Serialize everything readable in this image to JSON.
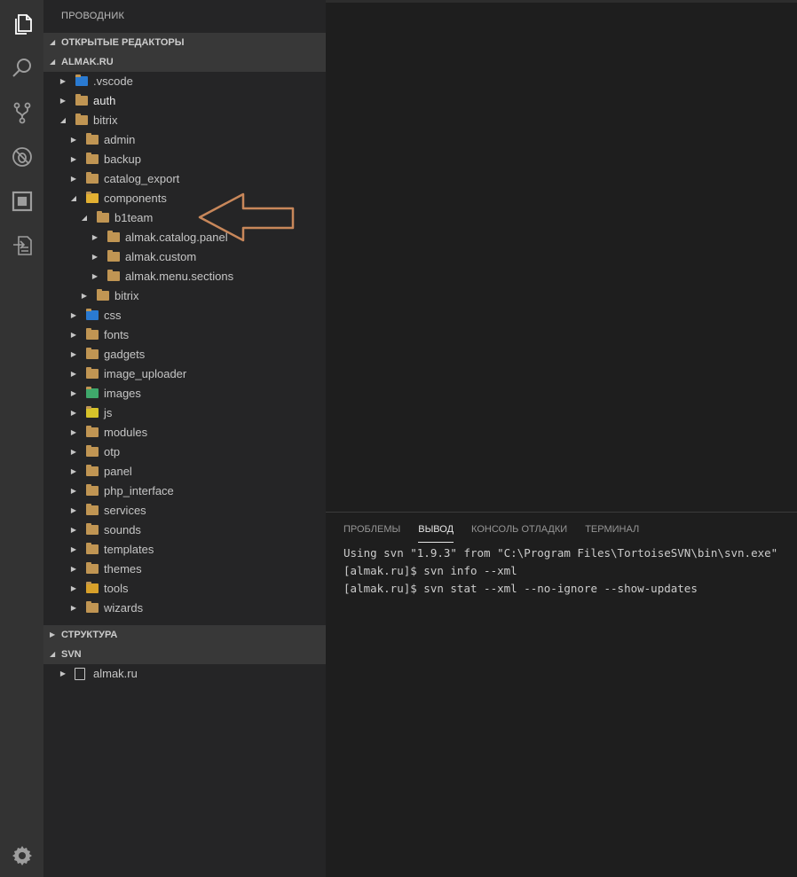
{
  "activity_bar": {
    "items": [
      "files-icon",
      "search-icon",
      "source-control-icon",
      "debug-icon",
      "extensions-icon",
      "remote-icon"
    ],
    "settings": "gear-icon"
  },
  "sidebar": {
    "title": "ПРОВОДНИК",
    "open_editors": "ОТКРЫТЫЕ РЕДАКТОРЫ",
    "workspace": "ALMAK.RU",
    "tree": [
      {
        "label": ".vscode",
        "depth": 0,
        "expanded": false,
        "icon": "vscode-folder"
      },
      {
        "label": "auth",
        "depth": 0,
        "expanded": false,
        "icon": "folder",
        "bold": true
      },
      {
        "label": "bitrix",
        "depth": 0,
        "expanded": true,
        "icon": "folder-open"
      },
      {
        "label": "admin",
        "depth": 1,
        "expanded": false,
        "icon": "folder"
      },
      {
        "label": "backup",
        "depth": 1,
        "expanded": false,
        "icon": "folder"
      },
      {
        "label": "catalog_export",
        "depth": 1,
        "expanded": false,
        "icon": "folder"
      },
      {
        "label": "components",
        "depth": 1,
        "expanded": true,
        "icon": "folder-component"
      },
      {
        "label": "b1team",
        "depth": 2,
        "expanded": true,
        "icon": "folder-open"
      },
      {
        "label": "almak.catalog.panel",
        "depth": 3,
        "expanded": false,
        "icon": "folder"
      },
      {
        "label": "almak.custom",
        "depth": 3,
        "expanded": false,
        "icon": "folder"
      },
      {
        "label": "almak.menu.sections",
        "depth": 3,
        "expanded": false,
        "icon": "folder"
      },
      {
        "label": "bitrix",
        "depth": 2,
        "expanded": false,
        "icon": "folder"
      },
      {
        "label": "css",
        "depth": 1,
        "expanded": false,
        "icon": "folder-css"
      },
      {
        "label": "fonts",
        "depth": 1,
        "expanded": false,
        "icon": "folder-fonts"
      },
      {
        "label": "gadgets",
        "depth": 1,
        "expanded": false,
        "icon": "folder"
      },
      {
        "label": "image_uploader",
        "depth": 1,
        "expanded": false,
        "icon": "folder"
      },
      {
        "label": "images",
        "depth": 1,
        "expanded": false,
        "icon": "folder-images"
      },
      {
        "label": "js",
        "depth": 1,
        "expanded": false,
        "icon": "folder-js"
      },
      {
        "label": "modules",
        "depth": 1,
        "expanded": false,
        "icon": "folder"
      },
      {
        "label": "otp",
        "depth": 1,
        "expanded": false,
        "icon": "folder"
      },
      {
        "label": "panel",
        "depth": 1,
        "expanded": false,
        "icon": "folder"
      },
      {
        "label": "php_interface",
        "depth": 1,
        "expanded": false,
        "icon": "folder"
      },
      {
        "label": "services",
        "depth": 1,
        "expanded": false,
        "icon": "folder"
      },
      {
        "label": "sounds",
        "depth": 1,
        "expanded": false,
        "icon": "folder"
      },
      {
        "label": "templates",
        "depth": 1,
        "expanded": false,
        "icon": "folder-templates"
      },
      {
        "label": "themes",
        "depth": 1,
        "expanded": false,
        "icon": "folder"
      },
      {
        "label": "tools",
        "depth": 1,
        "expanded": false,
        "icon": "folder-tools"
      },
      {
        "label": "wizards",
        "depth": 1,
        "expanded": false,
        "icon": "folder"
      }
    ],
    "outline": "СТРУКТУРА",
    "svn": "SVN",
    "svn_items": [
      "almak.ru"
    ]
  },
  "panel": {
    "tabs": [
      "ПРОБЛЕМЫ",
      "ВЫВОД",
      "КОНСОЛЬ ОТЛАДКИ",
      "ТЕРМИНАЛ"
    ],
    "active_tab": 1,
    "output": [
      "Using svn \"1.9.3\" from \"C:\\Program Files\\TortoiseSVN\\bin\\svn.exe\"",
      "[almak.ru]$ svn info --xml",
      "[almak.ru]$ svn stat --xml --no-ignore --show-updates"
    ]
  },
  "colors": {
    "folder": "#c09553",
    "arrow_annotation": "#c8875a",
    "activity_bar": "#333333",
    "sidebar": "#252526",
    "editor": "#1e1e1e"
  }
}
